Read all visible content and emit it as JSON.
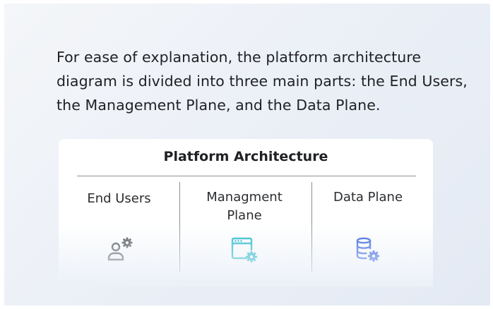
{
  "intro_text": "For ease of explanation, the platform architecture diagram is divided into three main parts: the End Users, the Management Plane, and the Data Plane.",
  "card": {
    "title": "Platform Architecture",
    "columns": [
      {
        "label": "End Users",
        "icon": "user-gear-icon"
      },
      {
        "label": "Managment Plane",
        "icon": "window-gear-icon"
      },
      {
        "label": "Data Plane",
        "icon": "database-gear-icon"
      }
    ]
  },
  "colors": {
    "text": "#202124",
    "divider": "#8a8f96",
    "user_icon": "#55585c",
    "management_icon": "#20b8c8",
    "data_icon": "#2f5fdf"
  }
}
